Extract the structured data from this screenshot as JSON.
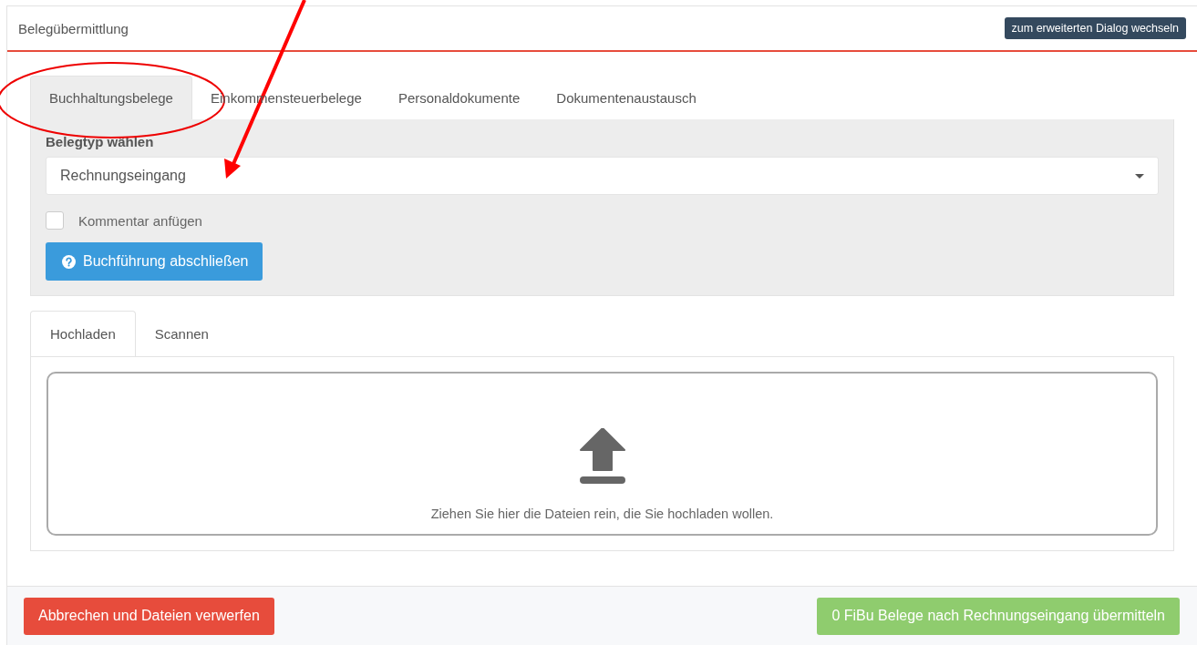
{
  "header": {
    "title": "Belegübermittlung",
    "switch_button": "zum erweiterten Dialog wechseln"
  },
  "tabs": [
    {
      "label": "Buchhaltungsbelege",
      "selected": true
    },
    {
      "label": "Einkommensteuerbelege",
      "selected": false
    },
    {
      "label": "Personaldokumente",
      "selected": false
    },
    {
      "label": "Dokumentenaustausch",
      "selected": false
    }
  ],
  "form": {
    "type_label": "Belegtyp wählen",
    "type_value": "Rechnungseingang",
    "comment": {
      "label": "Kommentar anfügen",
      "checked": false
    },
    "close_button": "Buchführung abschließen"
  },
  "upload_tabs": [
    {
      "label": "Hochladen",
      "selected": true
    },
    {
      "label": "Scannen",
      "selected": false
    }
  ],
  "dropzone": {
    "hint": "Ziehen Sie hier die Dateien rein, die Sie hochladen wollen."
  },
  "footer": {
    "cancel_button": "Abbrechen und Dateien verwerfen",
    "submit_button": "0 FiBu Belege nach Rechnungseingang übermitteln"
  }
}
